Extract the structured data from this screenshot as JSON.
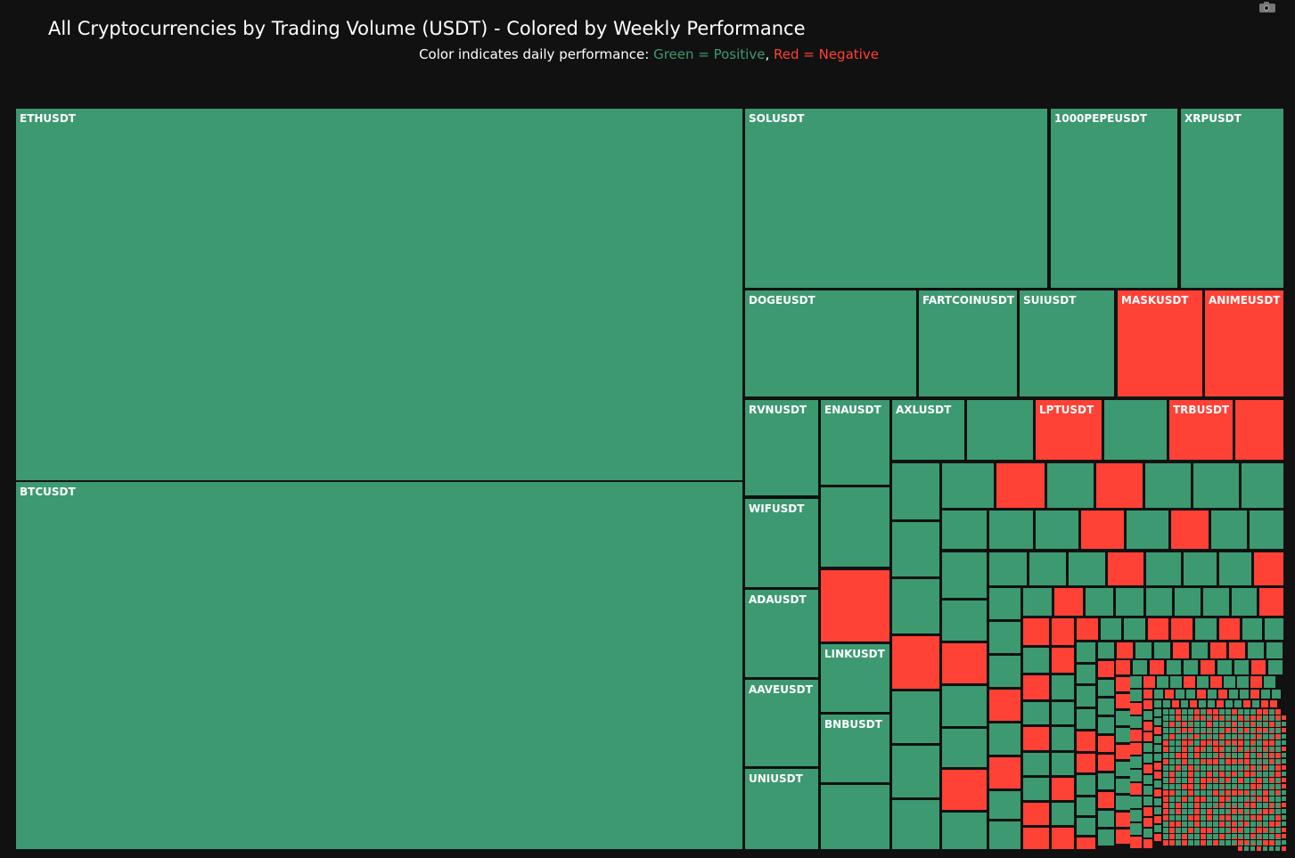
{
  "title": "All Cryptocurrencies by Trading Volume (USDT) - Colored by Weekly Performance",
  "subtitle": {
    "prefix": "Color indicates daily performance: ",
    "green_text": "Green = Positive",
    "separator": ", ",
    "red_text": "Red = Negative"
  },
  "toolbar": {
    "camera_icon": "camera-icon"
  },
  "colors": {
    "background": "#111111",
    "positive": "#3d9970",
    "negative": "#ff4136",
    "border": "#111111"
  },
  "chart_data": {
    "type": "treemap",
    "value_metric": "trading volume (USDT)",
    "color_metric": "performance",
    "named_tiles": [
      {
        "label": "ETHUSDT",
        "sign": "positive"
      },
      {
        "label": "BTCUSDT",
        "sign": "positive"
      },
      {
        "label": "SOLUSDT",
        "sign": "positive"
      },
      {
        "label": "1000PEPEUSDT",
        "sign": "positive"
      },
      {
        "label": "XRPUSDT",
        "sign": "positive"
      },
      {
        "label": "DOGEUSDT",
        "sign": "positive"
      },
      {
        "label": "FARTCOINUSDT",
        "sign": "positive"
      },
      {
        "label": "SUIUSDT",
        "sign": "positive"
      },
      {
        "label": "MASKUSDT",
        "sign": "negative"
      },
      {
        "label": "ANIMEUSDT",
        "sign": "negative"
      },
      {
        "label": "RVNUSDT",
        "sign": "positive"
      },
      {
        "label": "ENAUSDT",
        "sign": "positive"
      },
      {
        "label": "AXLUSDT",
        "sign": "positive"
      },
      {
        "label": "LPTUSDT",
        "sign": "negative"
      },
      {
        "label": "TRBUSDT",
        "sign": "negative"
      },
      {
        "label": "WIFUSDT",
        "sign": "positive"
      },
      {
        "label": "ADAUSDT",
        "sign": "positive"
      },
      {
        "label": "LINKUSDT",
        "sign": "positive"
      },
      {
        "label": "AAVEUSDT",
        "sign": "positive"
      },
      {
        "label": "BNBUSDT",
        "sign": "positive"
      },
      {
        "label": "UNIUSDT",
        "sign": "positive"
      }
    ]
  }
}
